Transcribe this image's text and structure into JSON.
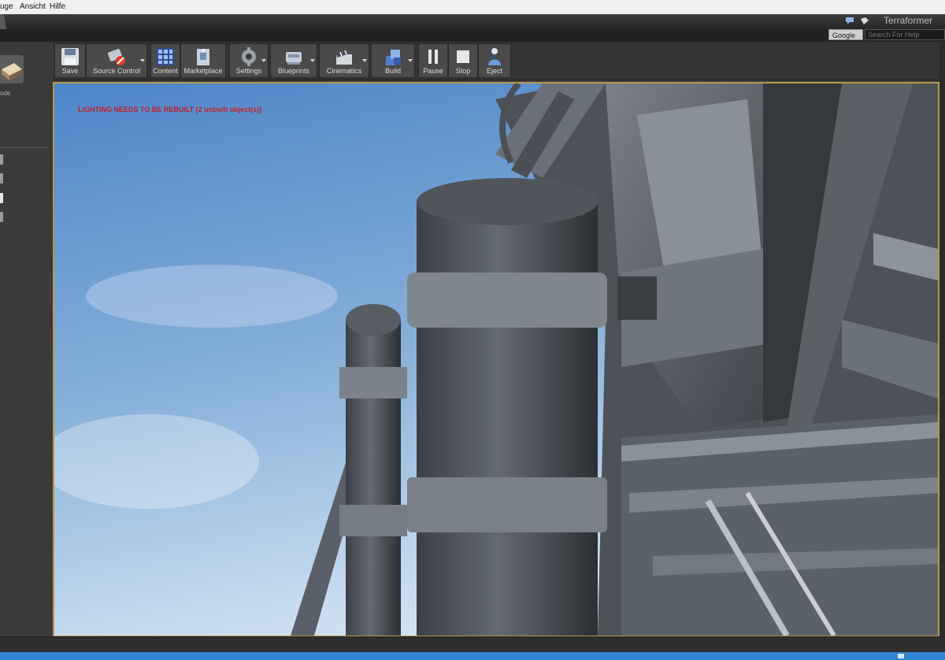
{
  "menu": [
    "uge",
    "Ansicht",
    "Hilfe"
  ],
  "project_title": "Terraformer",
  "help": {
    "engine_label": "Google",
    "search_placeholder": "Search For Help"
  },
  "left_panel": {
    "mode_label": "ode"
  },
  "toolbar": [
    {
      "id": "save",
      "label": "Save",
      "icon": "save-icon",
      "dropdown": false
    },
    {
      "id": "source-control",
      "label": "Source Control",
      "icon": "source-control-icon",
      "dropdown": true
    },
    {
      "id": "content",
      "label": "Content",
      "icon": "content-icon",
      "dropdown": false
    },
    {
      "id": "marketplace",
      "label": "Marketplace",
      "icon": "marketplace-icon",
      "dropdown": false
    },
    {
      "id": "settings",
      "label": "Settings",
      "icon": "settings-icon",
      "dropdown": true
    },
    {
      "id": "blueprints",
      "label": "Blueprints",
      "icon": "blueprints-icon",
      "dropdown": true
    },
    {
      "id": "cinematics",
      "label": "Cinematics",
      "icon": "cinematics-icon",
      "dropdown": true
    },
    {
      "id": "build",
      "label": "Build",
      "icon": "build-icon",
      "dropdown": true
    },
    {
      "id": "pause",
      "label": "Pause",
      "icon": "pause-icon",
      "dropdown": false
    },
    {
      "id": "stop",
      "label": "Stop",
      "icon": "stop-icon",
      "dropdown": false
    },
    {
      "id": "eject",
      "label": "Eject",
      "icon": "eject-icon",
      "dropdown": false
    }
  ],
  "viewport": {
    "warning": "LIGHTING NEEDS TO BE REBUILT (2 unbuilt object(s))"
  },
  "colors": {
    "accent_border": "#b79a4a",
    "warning": "#c3202a",
    "sky": "#6f9fd3"
  }
}
